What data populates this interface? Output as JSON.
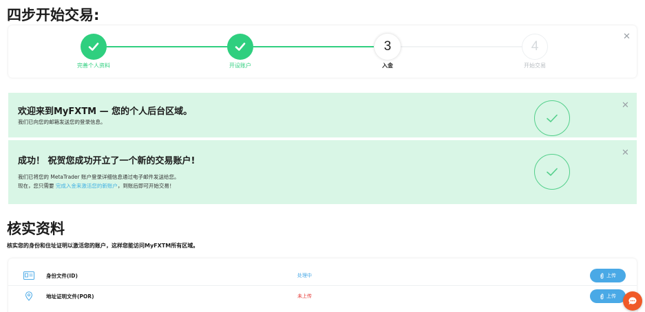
{
  "page": {
    "title": "四步开始交易:"
  },
  "colors": {
    "accent_green": "#2fcf7f",
    "alert_bg": "#d9f6e6",
    "upload_blue": "#4aa9e6",
    "status_processing": "#4aa9e6",
    "status_not_uploaded": "#e53935",
    "chat_orange": "#f05a28"
  },
  "steps": [
    {
      "label": "完善个人资料",
      "state": "done",
      "label_color": "#2fcf7f"
    },
    {
      "label": "开设账户",
      "state": "done",
      "label_color": "#2fcf7f"
    },
    {
      "label": "入金",
      "state": "current",
      "number": "3",
      "label_color": "#222222"
    },
    {
      "label": "开始交易",
      "state": "future",
      "number": "4",
      "label_color": "#b8bdc2"
    }
  ],
  "alerts": {
    "welcome": {
      "title": "欢迎来到MyFXTM — 您的个人后台区域。",
      "line1": "我们已向您的邮箱发送您的登录信息。"
    },
    "success": {
      "title": "成功！ 祝贺您成功开立了一个新的交易账户!",
      "line1": "我们已将您的 MetaTrader 账户登录详细信息通过电子邮件发送给您。",
      "line2_prefix": "现在，您只需要 ",
      "line2_link": "完成入金来激活您的新账户",
      "line2_suffix": "，到账后即可开始交易！"
    }
  },
  "verify": {
    "title": "核实资料",
    "subtitle": "核实您的身份和住址证明以激活您的账户，这样您能访问MyFXTM所有区域。",
    "docs": [
      {
        "name": "身份文件(ID)",
        "status": "处理中",
        "icon": "id-card-icon",
        "button": "上传"
      },
      {
        "name": "地址证明文件(POR)",
        "status": "未上传",
        "icon": "location-pin-icon",
        "button": "上传"
      }
    ]
  },
  "icons": {
    "close": "close-icon",
    "check": "checkmark-icon",
    "attach": "paperclip-icon",
    "chat": "chat-icon"
  }
}
